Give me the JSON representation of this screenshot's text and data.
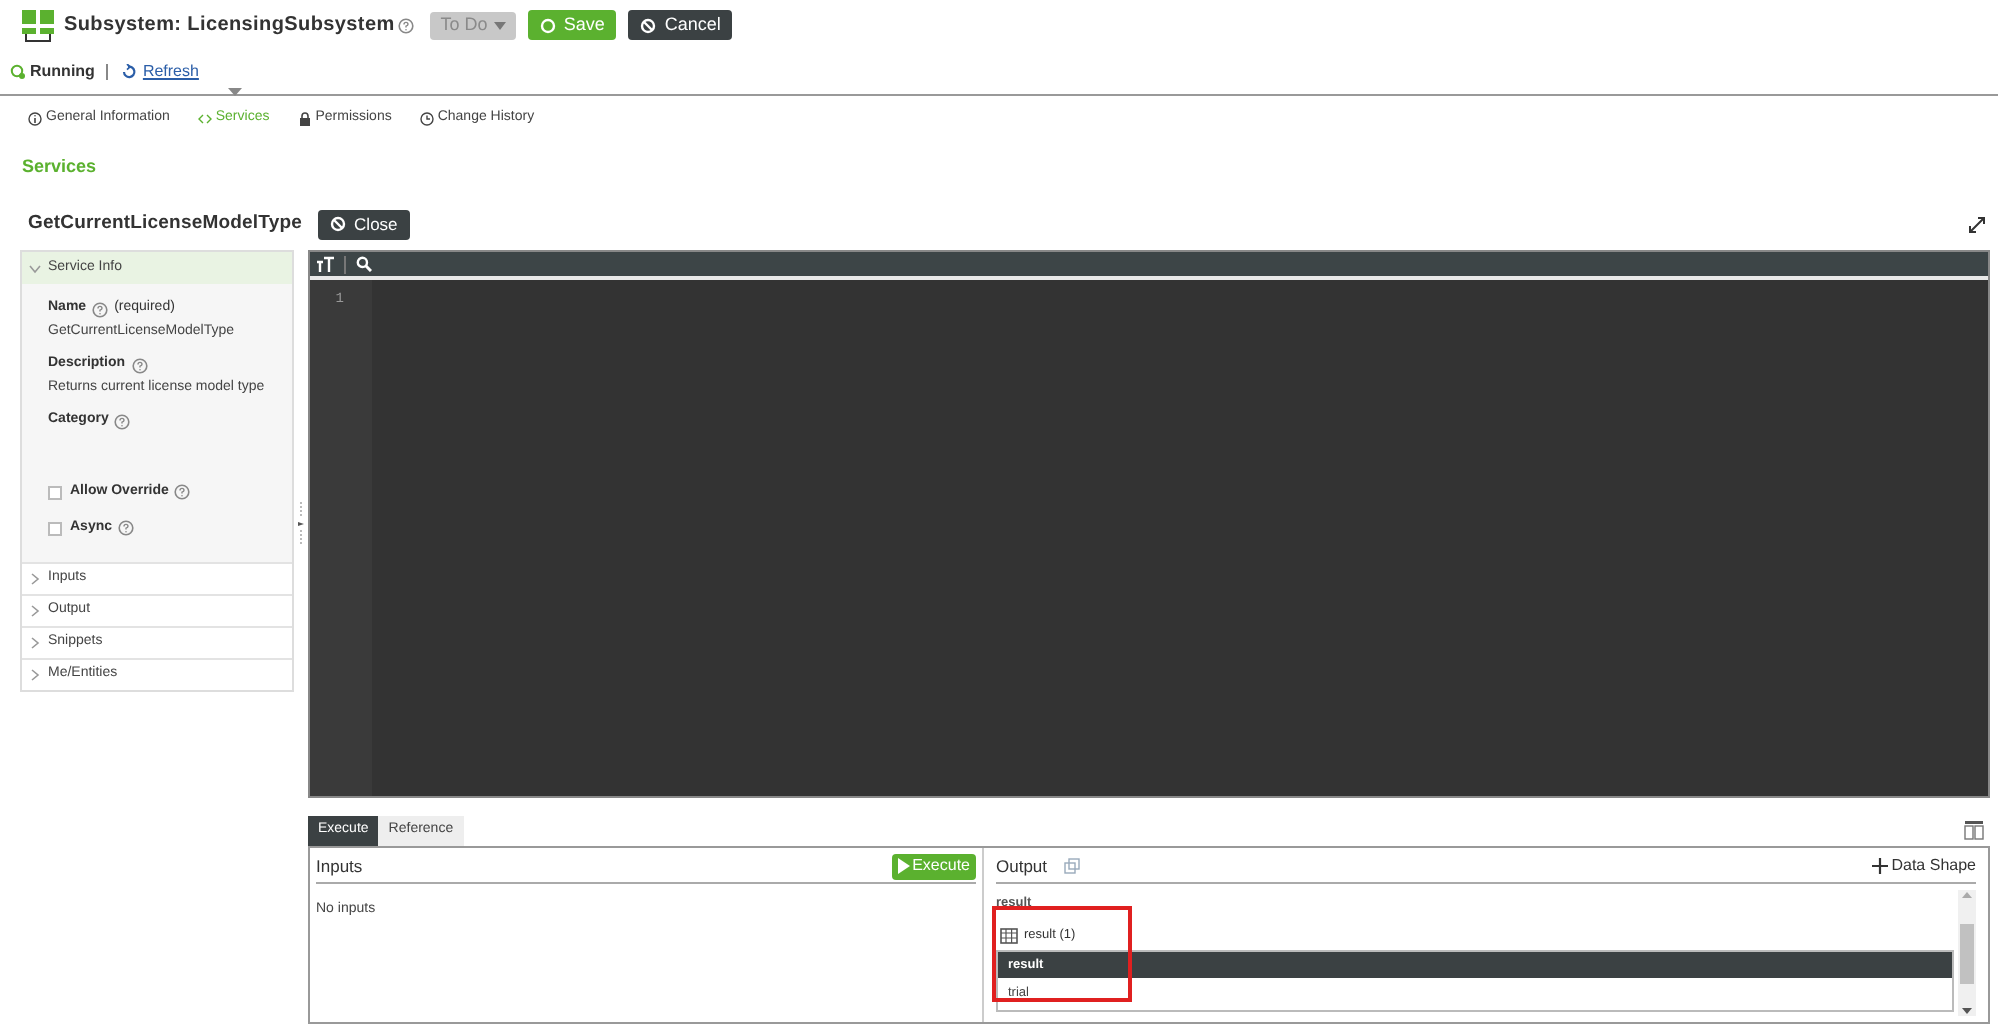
{
  "header": {
    "title": "Subsystem: LicensingSubsystem",
    "state_select": "To Do",
    "save_button": "Save",
    "cancel_button": "Cancel"
  },
  "status": {
    "label": "Running",
    "refresh": "Refresh"
  },
  "tabs": [
    {
      "label": "General Information",
      "kind": "info",
      "selected": false
    },
    {
      "label": "Services",
      "kind": "code",
      "selected": true
    },
    {
      "label": "Permissions",
      "kind": "lock",
      "selected": false
    },
    {
      "label": "Change History",
      "kind": "clock",
      "selected": false
    }
  ],
  "section_title": "Services",
  "service": {
    "name": "GetCurrentLicenseModelType",
    "close_button": "Close"
  },
  "service_info": {
    "header": "Service Info",
    "expanded": true,
    "fields": [
      {
        "label": "Name",
        "note": "(required)",
        "value": "GetCurrentLicenseModelType"
      },
      {
        "label": "Description",
        "value": "Returns current license model type"
      },
      {
        "label": "Category"
      }
    ],
    "checkboxes": [
      {
        "label": "Allow Override",
        "checked": false
      },
      {
        "label": "Async",
        "checked": false
      }
    ]
  },
  "sections": [
    {
      "label": "Inputs",
      "expanded": false
    },
    {
      "label": "Output",
      "expanded": false
    },
    {
      "label": "Snippets",
      "expanded": false
    },
    {
      "label": "Me/Entities",
      "expanded": false
    }
  ],
  "editor": {
    "line_numbers": [
      "1"
    ]
  },
  "bottom_tabs": [
    {
      "label": "Execute",
      "selected": true
    },
    {
      "label": "Reference",
      "selected": false
    }
  ],
  "inputs": {
    "title": "Inputs",
    "execute_button": "Execute",
    "message": "No inputs"
  },
  "output": {
    "title": "Output",
    "add_button": "Data Shape",
    "field_name": "result",
    "highlighted": true,
    "table": {
      "caption": "result (1)",
      "columns": [
        "result"
      ],
      "rows": [
        [
          "trial"
        ]
      ]
    }
  }
}
